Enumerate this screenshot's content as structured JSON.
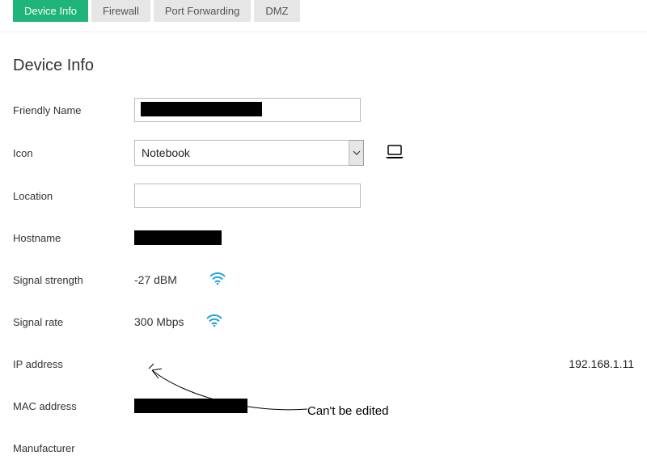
{
  "tabs": {
    "device_info": "Device Info",
    "firewall": "Firewall",
    "port_forwarding": "Port Forwarding",
    "dmz": "DMZ"
  },
  "heading": "Device Info",
  "labels": {
    "friendly_name": "Friendly Name",
    "icon": "Icon",
    "location": "Location",
    "hostname": "Hostname",
    "signal_strength": "Signal strength",
    "signal_rate": "Signal rate",
    "ip_address": "IP address",
    "mac_address": "MAC address",
    "manufacturer": "Manufacturer"
  },
  "values": {
    "friendly_name": "",
    "icon_selected": "Notebook",
    "location": "",
    "signal_strength": "-27 dBM",
    "signal_rate": "300 Mbps",
    "ip_address": "192.168.1.11"
  },
  "annotation": "Can't be edited",
  "colors": {
    "accent": "#1fb479",
    "wifi": "#1e9fe0"
  }
}
